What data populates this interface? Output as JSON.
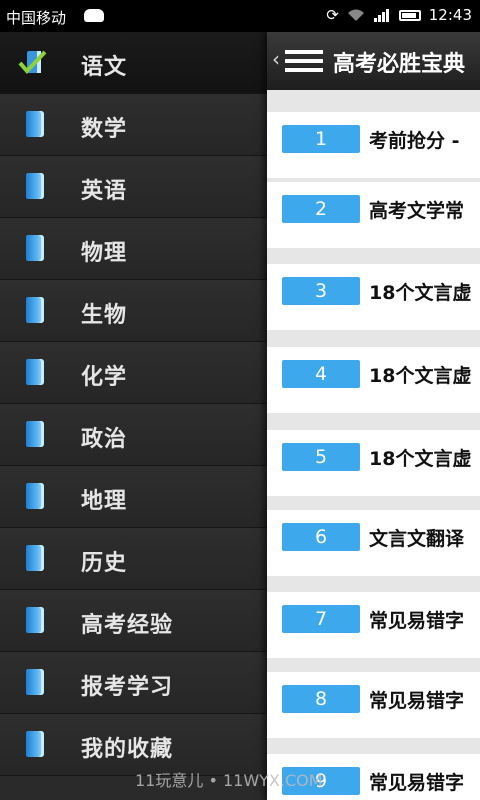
{
  "status_bar": {
    "carrier": "中国移动",
    "time": "12:43"
  },
  "sidebar": {
    "items": [
      {
        "label": "语文",
        "icon": "checkmark-book-icon",
        "active": true
      },
      {
        "label": "数学",
        "icon": "book-icon"
      },
      {
        "label": "英语",
        "icon": "book-icon"
      },
      {
        "label": "物理",
        "icon": "book-icon"
      },
      {
        "label": "生物",
        "icon": "book-icon"
      },
      {
        "label": "化学",
        "icon": "book-icon"
      },
      {
        "label": "政治",
        "icon": "book-icon"
      },
      {
        "label": "地理",
        "icon": "book-icon"
      },
      {
        "label": "历史",
        "icon": "book-icon"
      },
      {
        "label": "高考经验",
        "icon": "book-icon"
      },
      {
        "label": "报考学习",
        "icon": "book-icon"
      },
      {
        "label": "我的收藏",
        "icon": "book-icon"
      }
    ]
  },
  "header": {
    "title": "高考必胜宝典"
  },
  "list": [
    {
      "num": "1",
      "text": "考前抢分 -"
    },
    {
      "num": "2",
      "text": "高考文学常"
    },
    {
      "num": "3",
      "text": "18个文言虚"
    },
    {
      "num": "4",
      "text": "18个文言虚"
    },
    {
      "num": "5",
      "text": "18个文言虚"
    },
    {
      "num": "6",
      "text": "文言文翻译"
    },
    {
      "num": "7",
      "text": "常见易错字"
    },
    {
      "num": "8",
      "text": "常见易错字"
    },
    {
      "num": "9",
      "text": "常见易错字"
    }
  ],
  "watermark": "11玩意儿 • 11WYX.COM",
  "colors": {
    "accent": "#3da8ec",
    "sidebar_bg": "#2a2a2a",
    "list_bg": "#e6e6e6"
  }
}
